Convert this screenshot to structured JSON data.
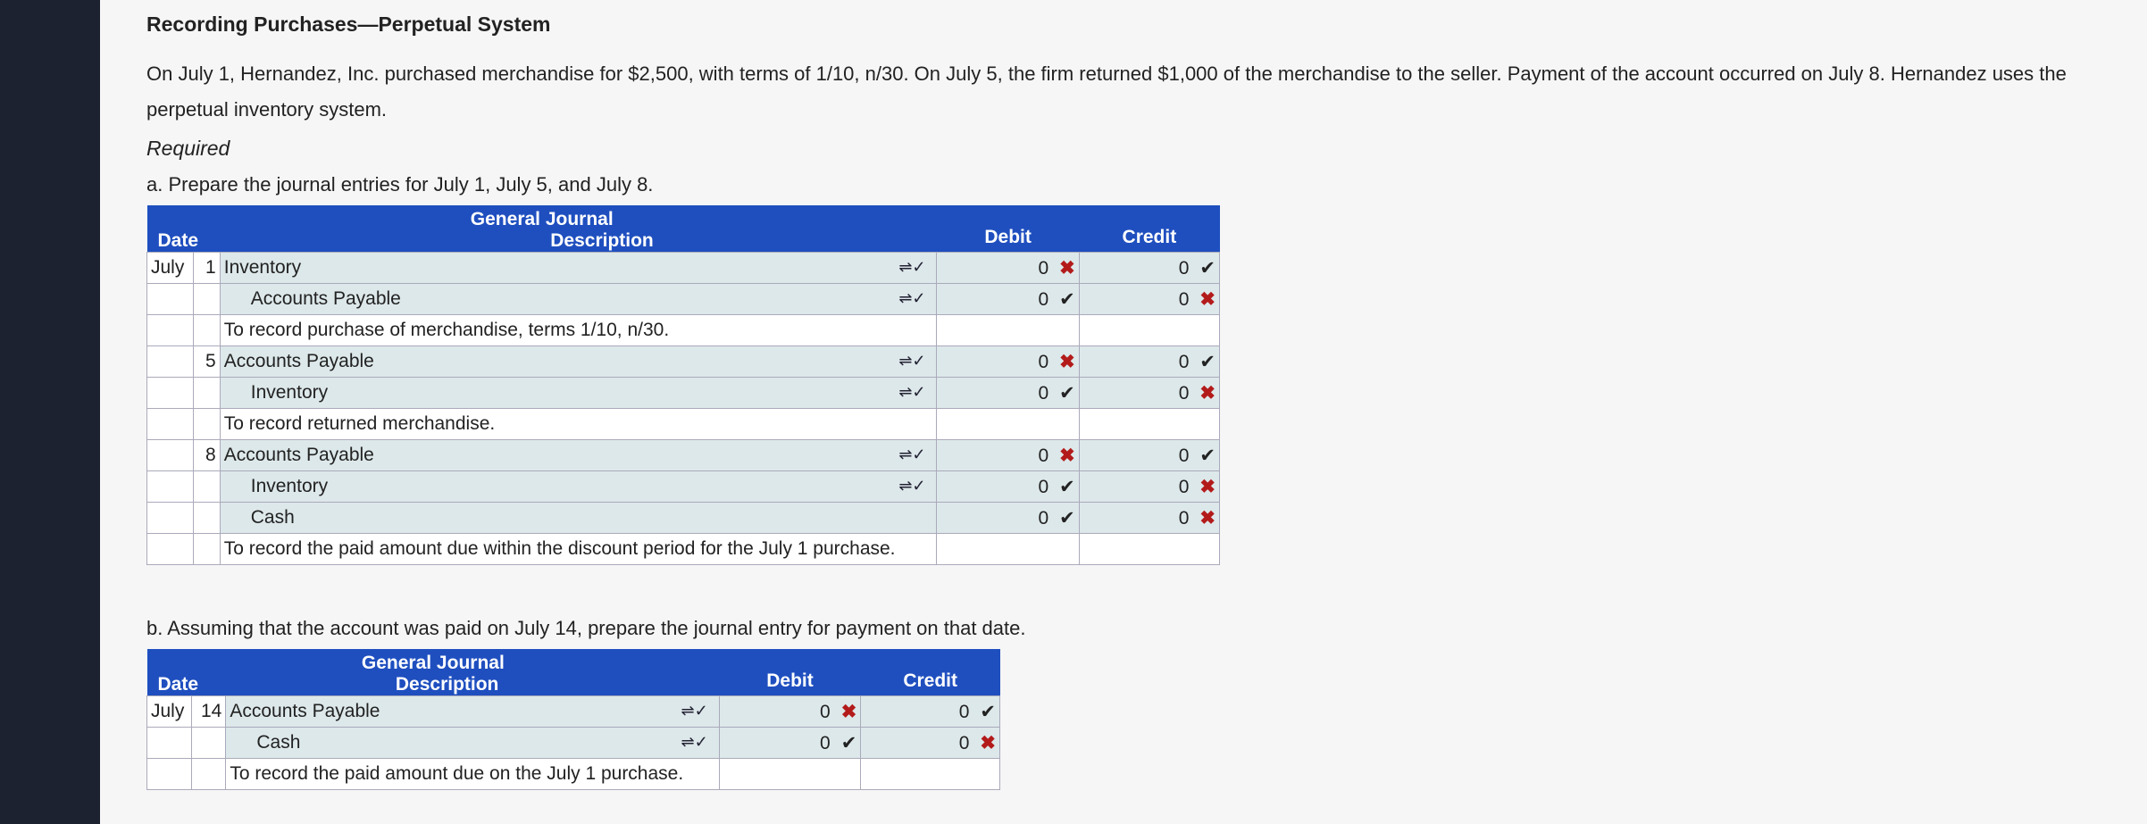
{
  "title": "Recording Purchases—Perpetual System",
  "problem": "On July 1, Hernandez, Inc. purchased merchandise for $2,500, with terms of 1/10, n/30. On July 5, the firm returned $1,000 of the merchandise to the seller. Payment of the account occurred on July 8. Hernandez uses the perpetual inventory system.",
  "required": "Required",
  "part_a": "a. Prepare the journal entries for July 1, July 5, and July 8.",
  "part_b": "b. Assuming that the account was paid on July 14, prepare the journal entry for payment on that date.",
  "journal_header": {
    "title": "General Journal",
    "date": "Date",
    "description": "Description",
    "debit": "Debit",
    "credit": "Credit"
  },
  "table_a": {
    "month": "July",
    "rows": [
      {
        "day": "1",
        "account": "Inventory",
        "indent": false,
        "debit": "0",
        "debit_mark": "✖",
        "credit": "0",
        "credit_mark": "✔"
      },
      {
        "day": "",
        "account": "Accounts Payable",
        "indent": true,
        "debit": "0",
        "debit_mark": "✔",
        "credit": "0",
        "credit_mark": "✖"
      },
      {
        "memo": "To record purchase of merchandise, terms 1/10, n/30."
      },
      {
        "day": "5",
        "account": "Accounts Payable",
        "indent": false,
        "debit": "0",
        "debit_mark": "✖",
        "credit": "0",
        "credit_mark": "✔"
      },
      {
        "day": "",
        "account": "Inventory",
        "indent": true,
        "debit": "0",
        "debit_mark": "✔",
        "credit": "0",
        "credit_mark": "✖"
      },
      {
        "memo": "To record returned merchandise."
      },
      {
        "day": "8",
        "account": "Accounts Payable",
        "indent": false,
        "debit": "0",
        "debit_mark": "✖",
        "credit": "0",
        "credit_mark": "✔"
      },
      {
        "day": "",
        "account": "Inventory",
        "indent": true,
        "debit": "0",
        "debit_mark": "✔",
        "credit": "0",
        "credit_mark": "✖"
      },
      {
        "day": "",
        "account": "Cash",
        "indent": true,
        "no_arrow": true,
        "debit": "0",
        "debit_mark": "✔",
        "credit": "0",
        "credit_mark": "✖"
      },
      {
        "memo": "To record the paid amount due within the discount period for the July 1 purchase."
      }
    ]
  },
  "table_b": {
    "month": "July",
    "rows": [
      {
        "day": "14",
        "account": "Accounts Payable",
        "indent": false,
        "debit": "0",
        "debit_mark": "✖",
        "credit": "0",
        "credit_mark": "✔"
      },
      {
        "day": "",
        "account": "Cash",
        "indent": true,
        "debit": "0",
        "debit_mark": "✔",
        "credit": "0",
        "credit_mark": "✖"
      },
      {
        "memo": "To record the paid amount due on the July 1 purchase."
      }
    ]
  },
  "dropdown_glyph": "⇌✓"
}
